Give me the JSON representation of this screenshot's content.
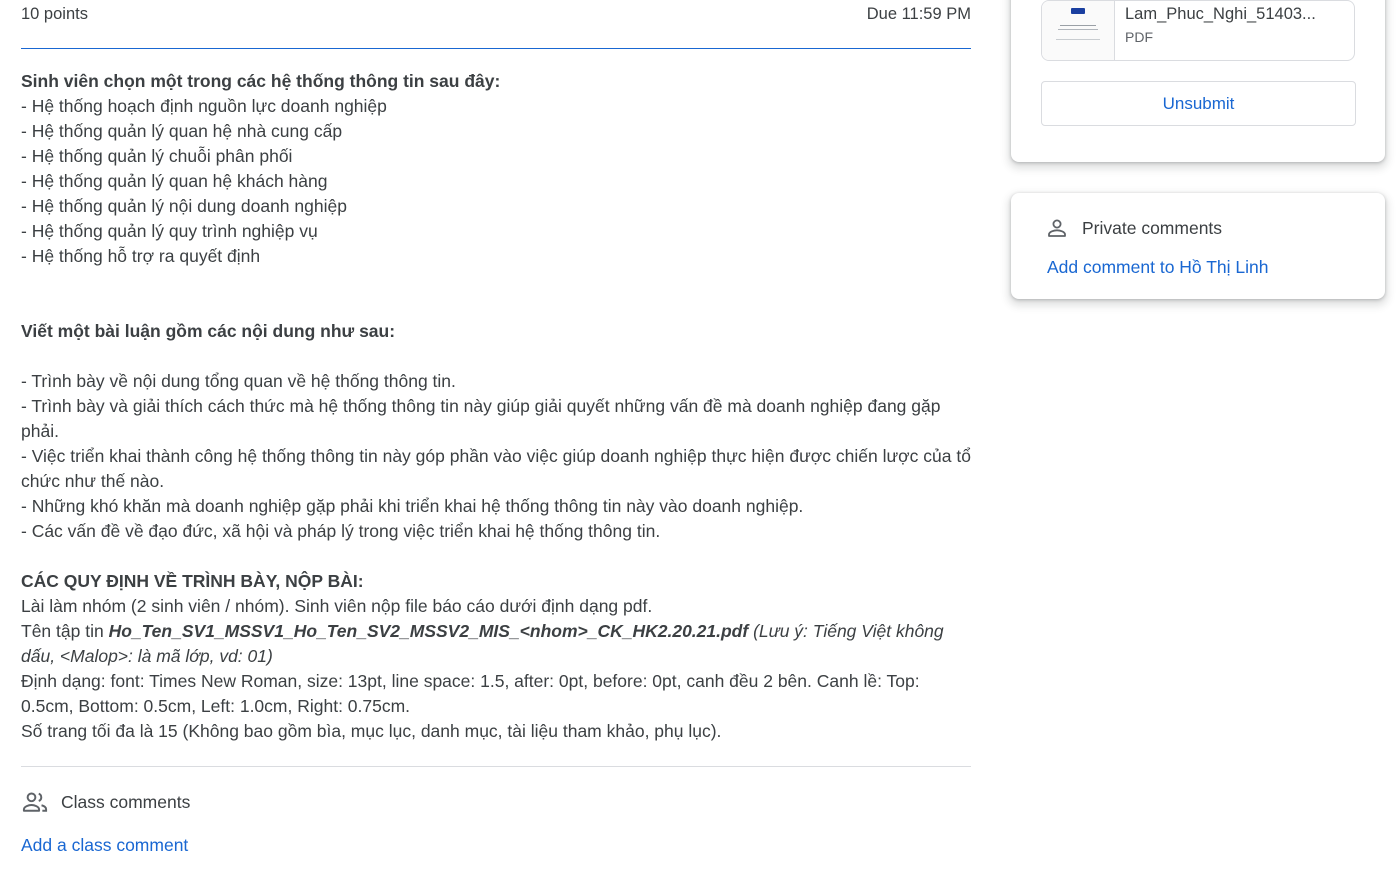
{
  "assignment": {
    "points": "10 points",
    "due": "Due 11:59 PM"
  },
  "instructions": {
    "section1_heading": "Sinh viên chọn một trong các hệ thống thông tin sau đây:",
    "systems": [
      "- Hệ thống hoạch định nguồn lực doanh nghiệp",
      "- Hệ thống quản lý quan hệ nhà cung cấp",
      "- Hệ thống quản lý chuỗi phân phối",
      "- Hệ thống quản lý quan hệ khách hàng",
      "- Hệ thống quản lý nội dung doanh nghiệp",
      "- Hệ thống quản lý quy trình nghiệp vụ",
      "- Hệ thống hỗ trợ ra quyết định"
    ],
    "section2_heading": "Viết một bài luận gồm các nội dung như sau:",
    "essay_points": [
      "- Trình bày về nội dung tổng quan về hệ thống thông tin.",
      "- Trình bày và giải thích cách thức mà hệ thống thông tin này giúp giải quyết những vấn đề mà doanh nghiệp đang gặp phải.",
      "- Việc triển khai thành công hệ thống thông tin này góp phần vào việc giúp doanh nghiệp thực hiện được chiến lược của tổ chức như thế nào.",
      "- Những khó khăn mà doanh nghiệp gặp phải khi triển khai hệ thống thông tin này vào doanh nghiệp.",
      "- Các vấn đề về đạo đức, xã hội và pháp lý trong việc triển khai hệ thống thông tin."
    ],
    "section3_heading": "CÁC QUY ĐỊNH VỀ TRÌNH BÀY, NỘP BÀI:",
    "rule_group": "Lài làm nhóm (2 sinh viên / nhóm). Sinh viên nộp file báo cáo dưới định dạng pdf.",
    "rule_filename_prefix": "Tên tập tin ",
    "rule_filename_pattern": "Ho_Ten_SV1_MSSV1_Ho_Ten_SV2_MSSV2_MIS_<nhom>_CK_HK2.20.21.pdf",
    "rule_filename_note": " (Lưu ý: Tiếng Việt không dấu, <Malop>: là mã lớp, vd: 01)",
    "rule_format": "Định dạng: font: Times New Roman, size: 13pt, line space: 1.5, after: 0pt, before: 0pt, canh đều 2 bên. Canh lề: Top: 0.5cm, Bottom: 0.5cm, Left: 1.0cm, Right: 0.75cm.",
    "rule_pages": "Số trang tối đa là 15 (Không bao gồm bìa, mục lục, danh mục, tài liệu tham khảo, phụ lục)."
  },
  "class_comments": {
    "title": "Class comments",
    "add_label": "Add a class comment",
    "icon": "people-icon"
  },
  "your_work": {
    "attachment": {
      "name": "Lam_Phuc_Nghi_51403...",
      "type": "PDF"
    },
    "unsubmit_label": "Unsubmit"
  },
  "private_comments": {
    "title": "Private comments",
    "add_label": "Add comment to Hồ Thị Linh",
    "icon": "person-icon"
  },
  "colors": {
    "accent": "#1967d2",
    "text": "#3c4043",
    "divider": "#dadce0"
  }
}
